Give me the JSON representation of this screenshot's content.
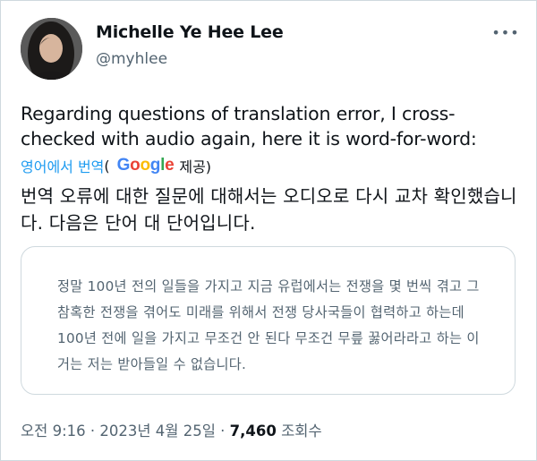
{
  "tweet": {
    "author_name": "Michelle Ye Hee Lee",
    "author_handle": "@myhlee",
    "text": "Regarding questions of translation error, I cross-checked with audio again, here it is word-for-word:",
    "translate": {
      "link_text": "영어에서 번역",
      "open_paren": "(",
      "provider_google": "Google",
      "provider_suffix": "제공)"
    },
    "translated_text": "번역 오류에 대한 질문에 대해서는 오디오로 다시 교차 확인했습니다. 다음은 단어 대 단어입니다.",
    "quote_text": "정말 100년 전의 일들을 가지고 지금 유럽에서는 전쟁을 몇 번씩 겪고 그 참혹한 전쟁을 겪어도 미래를 위해서 전쟁 당사국들이 협력하고 하는데 100년 전에 일을 가지고 무조건 안 된다 무조건 무릎 꿇어라라고 하는 이거는 저는 받아들일 수 없습니다.",
    "timestamp": "오전 9:16 · 2023년 4월 25일 ·",
    "views_count": "7,460",
    "views_label": "조회수"
  },
  "icons": {
    "more": "more-dots-icon",
    "avatar": "avatar-photo"
  }
}
